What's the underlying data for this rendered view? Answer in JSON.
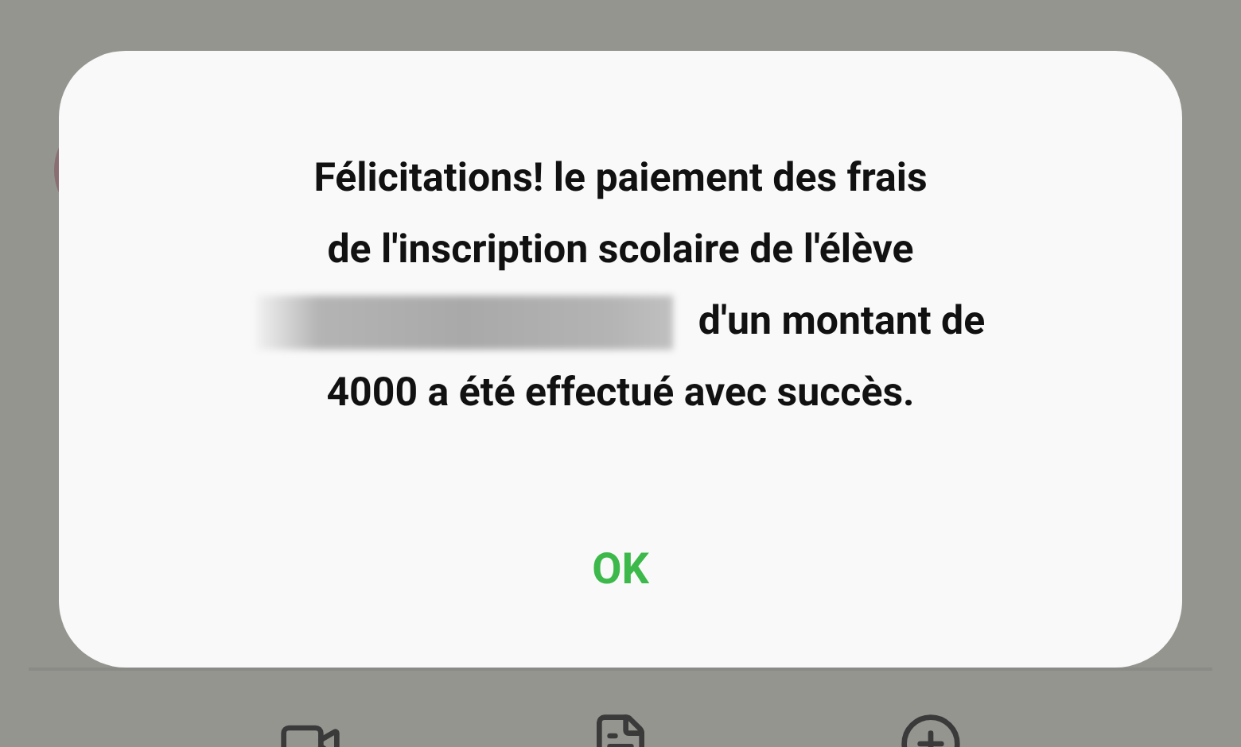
{
  "dialog": {
    "message_lines": [
      {
        "text": "Félicitations! le paiement des frais",
        "redacted": false
      },
      {
        "text": "de l'inscription scolaire de l'élève",
        "redacted": false
      },
      {
        "text": "d'un montant de",
        "redacted": true
      },
      {
        "text": "4000 a été effectué avec succès.",
        "redacted": false
      }
    ],
    "button": "OK"
  }
}
